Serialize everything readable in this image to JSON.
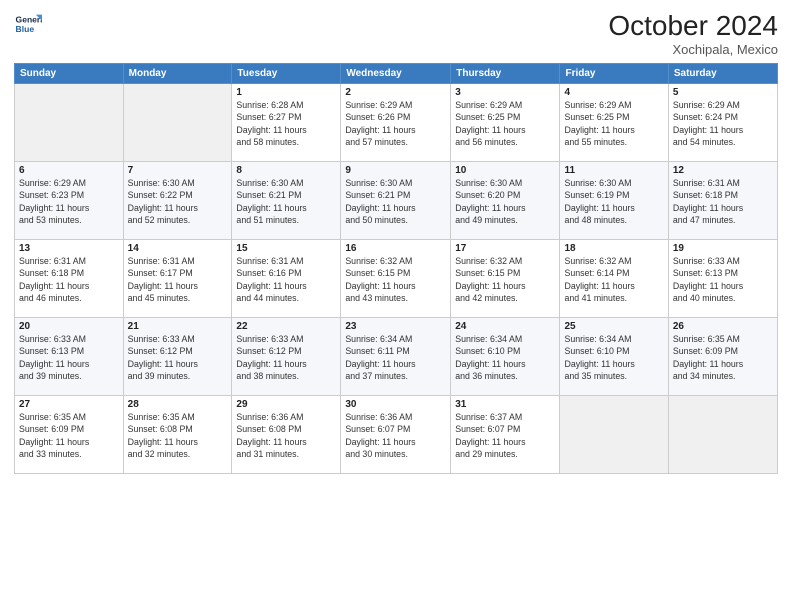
{
  "header": {
    "logo_line1": "General",
    "logo_line2": "Blue",
    "month_title": "October 2024",
    "location": "Xochipala, Mexico"
  },
  "weekdays": [
    "Sunday",
    "Monday",
    "Tuesday",
    "Wednesday",
    "Thursday",
    "Friday",
    "Saturday"
  ],
  "weeks": [
    [
      {
        "day": "",
        "info": ""
      },
      {
        "day": "",
        "info": ""
      },
      {
        "day": "1",
        "info": "Sunrise: 6:28 AM\nSunset: 6:27 PM\nDaylight: 11 hours\nand 58 minutes."
      },
      {
        "day": "2",
        "info": "Sunrise: 6:29 AM\nSunset: 6:26 PM\nDaylight: 11 hours\nand 57 minutes."
      },
      {
        "day": "3",
        "info": "Sunrise: 6:29 AM\nSunset: 6:25 PM\nDaylight: 11 hours\nand 56 minutes."
      },
      {
        "day": "4",
        "info": "Sunrise: 6:29 AM\nSunset: 6:25 PM\nDaylight: 11 hours\nand 55 minutes."
      },
      {
        "day": "5",
        "info": "Sunrise: 6:29 AM\nSunset: 6:24 PM\nDaylight: 11 hours\nand 54 minutes."
      }
    ],
    [
      {
        "day": "6",
        "info": "Sunrise: 6:29 AM\nSunset: 6:23 PM\nDaylight: 11 hours\nand 53 minutes."
      },
      {
        "day": "7",
        "info": "Sunrise: 6:30 AM\nSunset: 6:22 PM\nDaylight: 11 hours\nand 52 minutes."
      },
      {
        "day": "8",
        "info": "Sunrise: 6:30 AM\nSunset: 6:21 PM\nDaylight: 11 hours\nand 51 minutes."
      },
      {
        "day": "9",
        "info": "Sunrise: 6:30 AM\nSunset: 6:21 PM\nDaylight: 11 hours\nand 50 minutes."
      },
      {
        "day": "10",
        "info": "Sunrise: 6:30 AM\nSunset: 6:20 PM\nDaylight: 11 hours\nand 49 minutes."
      },
      {
        "day": "11",
        "info": "Sunrise: 6:30 AM\nSunset: 6:19 PM\nDaylight: 11 hours\nand 48 minutes."
      },
      {
        "day": "12",
        "info": "Sunrise: 6:31 AM\nSunset: 6:18 PM\nDaylight: 11 hours\nand 47 minutes."
      }
    ],
    [
      {
        "day": "13",
        "info": "Sunrise: 6:31 AM\nSunset: 6:18 PM\nDaylight: 11 hours\nand 46 minutes."
      },
      {
        "day": "14",
        "info": "Sunrise: 6:31 AM\nSunset: 6:17 PM\nDaylight: 11 hours\nand 45 minutes."
      },
      {
        "day": "15",
        "info": "Sunrise: 6:31 AM\nSunset: 6:16 PM\nDaylight: 11 hours\nand 44 minutes."
      },
      {
        "day": "16",
        "info": "Sunrise: 6:32 AM\nSunset: 6:15 PM\nDaylight: 11 hours\nand 43 minutes."
      },
      {
        "day": "17",
        "info": "Sunrise: 6:32 AM\nSunset: 6:15 PM\nDaylight: 11 hours\nand 42 minutes."
      },
      {
        "day": "18",
        "info": "Sunrise: 6:32 AM\nSunset: 6:14 PM\nDaylight: 11 hours\nand 41 minutes."
      },
      {
        "day": "19",
        "info": "Sunrise: 6:33 AM\nSunset: 6:13 PM\nDaylight: 11 hours\nand 40 minutes."
      }
    ],
    [
      {
        "day": "20",
        "info": "Sunrise: 6:33 AM\nSunset: 6:13 PM\nDaylight: 11 hours\nand 39 minutes."
      },
      {
        "day": "21",
        "info": "Sunrise: 6:33 AM\nSunset: 6:12 PM\nDaylight: 11 hours\nand 39 minutes."
      },
      {
        "day": "22",
        "info": "Sunrise: 6:33 AM\nSunset: 6:12 PM\nDaylight: 11 hours\nand 38 minutes."
      },
      {
        "day": "23",
        "info": "Sunrise: 6:34 AM\nSunset: 6:11 PM\nDaylight: 11 hours\nand 37 minutes."
      },
      {
        "day": "24",
        "info": "Sunrise: 6:34 AM\nSunset: 6:10 PM\nDaylight: 11 hours\nand 36 minutes."
      },
      {
        "day": "25",
        "info": "Sunrise: 6:34 AM\nSunset: 6:10 PM\nDaylight: 11 hours\nand 35 minutes."
      },
      {
        "day": "26",
        "info": "Sunrise: 6:35 AM\nSunset: 6:09 PM\nDaylight: 11 hours\nand 34 minutes."
      }
    ],
    [
      {
        "day": "27",
        "info": "Sunrise: 6:35 AM\nSunset: 6:09 PM\nDaylight: 11 hours\nand 33 minutes."
      },
      {
        "day": "28",
        "info": "Sunrise: 6:35 AM\nSunset: 6:08 PM\nDaylight: 11 hours\nand 32 minutes."
      },
      {
        "day": "29",
        "info": "Sunrise: 6:36 AM\nSunset: 6:08 PM\nDaylight: 11 hours\nand 31 minutes."
      },
      {
        "day": "30",
        "info": "Sunrise: 6:36 AM\nSunset: 6:07 PM\nDaylight: 11 hours\nand 30 minutes."
      },
      {
        "day": "31",
        "info": "Sunrise: 6:37 AM\nSunset: 6:07 PM\nDaylight: 11 hours\nand 29 minutes."
      },
      {
        "day": "",
        "info": ""
      },
      {
        "day": "",
        "info": ""
      }
    ]
  ]
}
